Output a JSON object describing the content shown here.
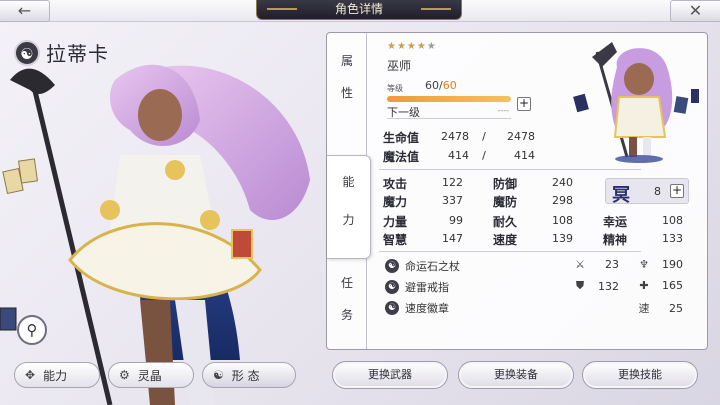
{
  "header": {
    "title": "角色详情",
    "back_icon": "arrow-left-icon",
    "close_icon": "close-icon"
  },
  "character": {
    "name": "拉蒂卡",
    "element_symbol": "☯",
    "class": "巫师",
    "stars_total": 5,
    "stars_filled": 4,
    "star_filled_glyph": "★★★★",
    "star_empty_glyph": "★",
    "level_label": "等级",
    "level": "60",
    "level_sep": "/",
    "level_max": "60",
    "exp_fraction": 1.0,
    "next_level_label": "下一级",
    "next_level_value": "----"
  },
  "tabs": {
    "attributes": "属性",
    "ability": "能力",
    "mission": "任务"
  },
  "vitals": {
    "hp": {
      "label": "生命值",
      "current": "2478",
      "sep": "/",
      "max": "2478"
    },
    "mp": {
      "label": "魔法值",
      "current": "414",
      "sep": "/",
      "max": "414"
    }
  },
  "stats": [
    {
      "label": "攻击",
      "value": "122"
    },
    {
      "label": "防御",
      "value": "240"
    },
    {
      "label": "魔力",
      "value": "337"
    },
    {
      "label": "魔防",
      "value": "298"
    },
    {
      "label": "力量",
      "value": "99"
    },
    {
      "label": "耐久",
      "value": "108"
    },
    {
      "label": "幸运",
      "value": "108"
    },
    {
      "label": "智慧",
      "value": "147"
    },
    {
      "label": "速度",
      "value": "139"
    },
    {
      "label": "精神",
      "value": "133"
    }
  ],
  "rank": {
    "symbol": "冥",
    "value": "8"
  },
  "equipment": [
    {
      "name": "命运石之杖",
      "icon": "staff-icon"
    },
    {
      "name": "避雷戒指",
      "icon": "ring-icon"
    },
    {
      "name": "速度徽章",
      "icon": "badge-icon"
    }
  ],
  "equip_stats": [
    {
      "icon": "sword-icon",
      "glyph": "⚔",
      "value": "23"
    },
    {
      "icon": "wand-icon",
      "glyph": "♆",
      "value": "190"
    },
    {
      "icon": "shield-icon",
      "glyph": "⛊",
      "value": "132"
    },
    {
      "icon": "cross-icon",
      "glyph": "✚",
      "value": "165"
    },
    {
      "icon": "speed-label",
      "glyph": "速",
      "value": "25"
    }
  ],
  "bottom_left": {
    "ability": "能力",
    "spirit": "灵晶",
    "form": "形 态"
  },
  "actions": {
    "change_weapon": "更换武器",
    "change_equipment": "更换装备",
    "change_skill": "更换技能"
  },
  "colors": {
    "accent_orange": "#f09a3a",
    "panel_border": "#9c99ab",
    "rank_blue": "#2a2f6e"
  }
}
